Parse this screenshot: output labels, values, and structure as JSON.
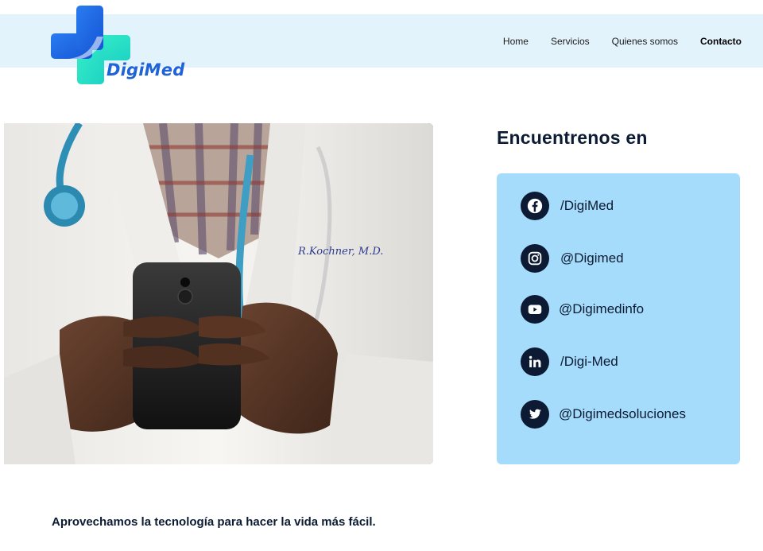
{
  "brand": {
    "name": "DigiMed"
  },
  "nav": {
    "items": [
      {
        "label": "Home",
        "active": false
      },
      {
        "label": "Servicios",
        "active": false
      },
      {
        "label": "Quienes somos",
        "active": false
      },
      {
        "label": "Contacto",
        "active": true
      }
    ]
  },
  "contact": {
    "title": "Encuentrenos en",
    "socials": [
      {
        "icon": "facebook-icon",
        "label": "/DigiMed"
      },
      {
        "icon": "instagram-icon",
        "label": "@Digimed"
      },
      {
        "icon": "youtube-icon",
        "label": "@Digimedinfo"
      },
      {
        "icon": "linkedin-icon",
        "label": "/Digi-Med"
      },
      {
        "icon": "twitter-icon",
        "label": "@Digimedsoluciones"
      }
    ]
  },
  "footer": {
    "tagline": "Aprovechamos la tecnología para hacer la vida más fácil."
  },
  "colors": {
    "header_bg": "#e3f3fc",
    "card_bg": "#a6dcfb",
    "navy": "#0c1b33",
    "brand_blue": "#1e63d8",
    "brand_teal": "#2ee0c0"
  }
}
